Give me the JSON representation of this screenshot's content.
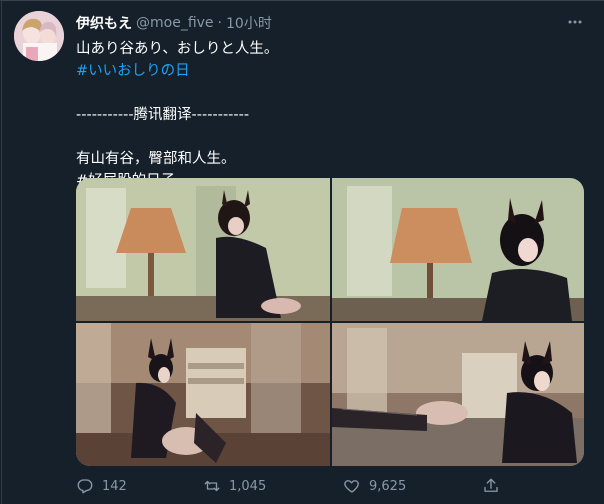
{
  "tweet": {
    "author": {
      "display_name": "伊织もえ",
      "handle": "@moe_five"
    },
    "time_separator": "·",
    "time": "10小时",
    "text_lines": [
      {
        "text": "山あり谷あり、おしりと人生。",
        "kind": "text"
      },
      {
        "text": "#いいおしりの日",
        "kind": "hashtag"
      },
      {
        "text": "",
        "kind": "blank"
      },
      {
        "text": "-----------腾讯翻译-----------",
        "kind": "text"
      },
      {
        "text": "",
        "kind": "blank"
      },
      {
        "text": "有山有谷，臀部和人生。",
        "kind": "text"
      },
      {
        "text": "#好屁股的日子",
        "kind": "text"
      }
    ],
    "actions": {
      "reply_count": "142",
      "retweet_count": "1,045",
      "like_count": "9,625",
      "share_icon": "share-icon"
    }
  },
  "colors": {
    "background": "#15202b",
    "secondary_text": "#8899a6",
    "link": "#1da1f2"
  }
}
